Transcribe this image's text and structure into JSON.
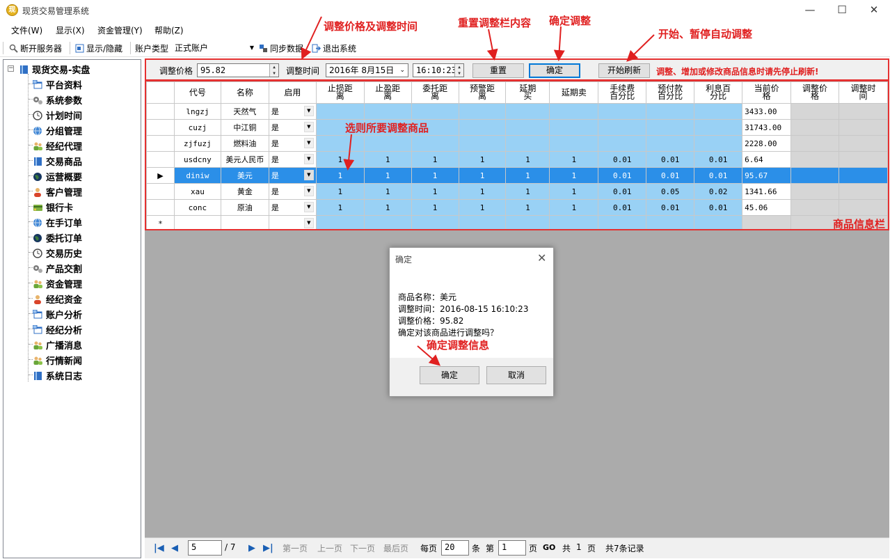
{
  "window": {
    "title": "现货交易管理系统",
    "controls": [
      "—",
      "☐",
      "✕"
    ]
  },
  "menu": [
    "文件(W)",
    "显示(X)",
    "资金管理(Y)",
    "帮助(Z)"
  ],
  "toolbar": {
    "disconnect": "断开服务器",
    "show_hide": "显示/隐藏",
    "account_type_label": "账户类型",
    "account_type_value": "正式账户",
    "sync": "同步数据",
    "exit": "退出系统"
  },
  "tree": {
    "root": "现货交易-实盘",
    "items": [
      {
        "label": "平台资料",
        "icon": "window-icon",
        "color": "#2f6fc4"
      },
      {
        "label": "系统参数",
        "icon": "gears-icon",
        "color": "#7a7a7a"
      },
      {
        "label": "计划时间",
        "icon": "clock-icon",
        "color": "#4a4a4a"
      },
      {
        "label": "分组管理",
        "icon": "globe-icon",
        "color": "#3f86d6"
      },
      {
        "label": "经纪代理",
        "icon": "users-icon",
        "color": "#6aa63a"
      },
      {
        "label": "交易商品",
        "icon": "book-icon",
        "color": "#2f6fc4"
      },
      {
        "label": "运营概要",
        "icon": "earth-icon",
        "color": "#16365f"
      },
      {
        "label": "客户管理",
        "icon": "user-icon",
        "color": "#d9442a"
      },
      {
        "label": "银行卡",
        "icon": "card-icon",
        "color": "#7fb241"
      },
      {
        "label": "在手订单",
        "icon": "globe-icon",
        "color": "#3f86d6"
      },
      {
        "label": "委托订单",
        "icon": "earth-icon",
        "color": "#16365f"
      },
      {
        "label": "交易历史",
        "icon": "clock-icon",
        "color": "#4a4a4a"
      },
      {
        "label": "产品交割",
        "icon": "gears-icon",
        "color": "#7a7a7a"
      },
      {
        "label": "资金管理",
        "icon": "users-icon",
        "color": "#6aa63a"
      },
      {
        "label": "经纪资金",
        "icon": "user-icon",
        "color": "#d9442a"
      },
      {
        "label": "账户分析",
        "icon": "window-icon",
        "color": "#2f6fc4"
      },
      {
        "label": "经纪分析",
        "icon": "window-icon",
        "color": "#2f6fc4"
      },
      {
        "label": "广播消息",
        "icon": "users-icon",
        "color": "#6aa63a"
      },
      {
        "label": "行情新闻",
        "icon": "users-icon",
        "color": "#6aa63a"
      },
      {
        "label": "系统日志",
        "icon": "book-icon",
        "color": "#2f6fc4"
      }
    ]
  },
  "adjust": {
    "price_label": "调整价格",
    "price_value": "95.82",
    "time_label": "调整时间",
    "date_value": "2016年 8月15日",
    "time_value": "16:10:23",
    "reset": "重置",
    "confirm": "确定",
    "start_refresh": "开始刷新",
    "notice": "调整、增加或修改商品信息时请先停止刷新!"
  },
  "grid": {
    "columns": [
      "代号",
      "名称",
      "启用",
      "止损距\n离",
      "止盈距\n离",
      "委托距\n离",
      "预警距\n离",
      "延期\n买",
      "延期卖",
      "手续费\n百分比",
      "预付款\n百分比",
      "利息百\n分比",
      "当前价\n格",
      "调整价\n格",
      "调整时\n间"
    ],
    "rows": [
      {
        "code": "lngzj",
        "name": "天然气",
        "enabled": "是",
        "vals": [
          "",
          "",
          "",
          "",
          "",
          "",
          "",
          "",
          ""
        ],
        "price": "3433.00",
        "selected": false
      },
      {
        "code": "cuzj",
        "name": "中江铜",
        "enabled": "是",
        "vals": [
          "",
          "",
          "",
          "",
          "",
          "",
          "",
          "",
          ""
        ],
        "price": "31743.00",
        "selected": false
      },
      {
        "code": "zjfuzj",
        "name": "燃料油",
        "enabled": "是",
        "vals": [
          "",
          "",
          "",
          "",
          "",
          "",
          "",
          "",
          ""
        ],
        "price": "2228.00",
        "selected": false
      },
      {
        "code": "usdcny",
        "name": "美元人民币",
        "enabled": "是",
        "vals": [
          "1",
          "1",
          "1",
          "1",
          "1",
          "1",
          "0.01",
          "0.01",
          "0.01"
        ],
        "price": "6.64",
        "selected": false
      },
      {
        "code": "diniw",
        "name": "美元",
        "enabled": "是",
        "vals": [
          "1",
          "1",
          "1",
          "1",
          "1",
          "1",
          "0.01",
          "0.01",
          "0.01"
        ],
        "price": "95.67",
        "selected": true
      },
      {
        "code": "xau",
        "name": "黄金",
        "enabled": "是",
        "vals": [
          "1",
          "1",
          "1",
          "1",
          "1",
          "1",
          "0.01",
          "0.05",
          "0.02"
        ],
        "price": "1341.66",
        "selected": false
      },
      {
        "code": "conc",
        "name": "原油",
        "enabled": "是",
        "vals": [
          "1",
          "1",
          "1",
          "1",
          "1",
          "1",
          "0.01",
          "0.01",
          "0.01"
        ],
        "price": "45.06",
        "selected": false
      }
    ],
    "new_row_marker": "*",
    "selected_marker": "▶"
  },
  "dialog": {
    "title": "确定",
    "line1": "商品名称：美元",
    "line2": "调整时间：2016-08-15 16:10:23",
    "line3": "调整价格：95.82",
    "line4": "确定对该商品进行调整吗？",
    "ok": "确定",
    "cancel": "取消"
  },
  "pager": {
    "page_value": "5",
    "total_pages": "/ 7",
    "first": "第一页",
    "prev": "上一页",
    "next": "下一页",
    "last": "最后页",
    "per_page_label": "每页",
    "per_page_value": "20",
    "unit": "条",
    "page_label": "第",
    "goto_value": "1",
    "page_unit": "页",
    "go": "GO",
    "total_label": "共",
    "total_value": "1",
    "total_unit": "页",
    "records": "共7条记录"
  },
  "annotations": {
    "adjust_price_time": "调整价格及调整时间",
    "reset_desc": "重置调整栏内容",
    "confirm_desc": "确定调整",
    "start_desc": "开始、暂停自动调整",
    "select_desc": "选则所要调整商品",
    "info_bar": "商品信息栏",
    "confirm_info": "确定调整信息"
  },
  "colors": {
    "annotation_red": "#e02020",
    "grid_blue": "#99d1f5",
    "selected_blue": "#2b8fe8",
    "empty_gray": "#ababab"
  }
}
